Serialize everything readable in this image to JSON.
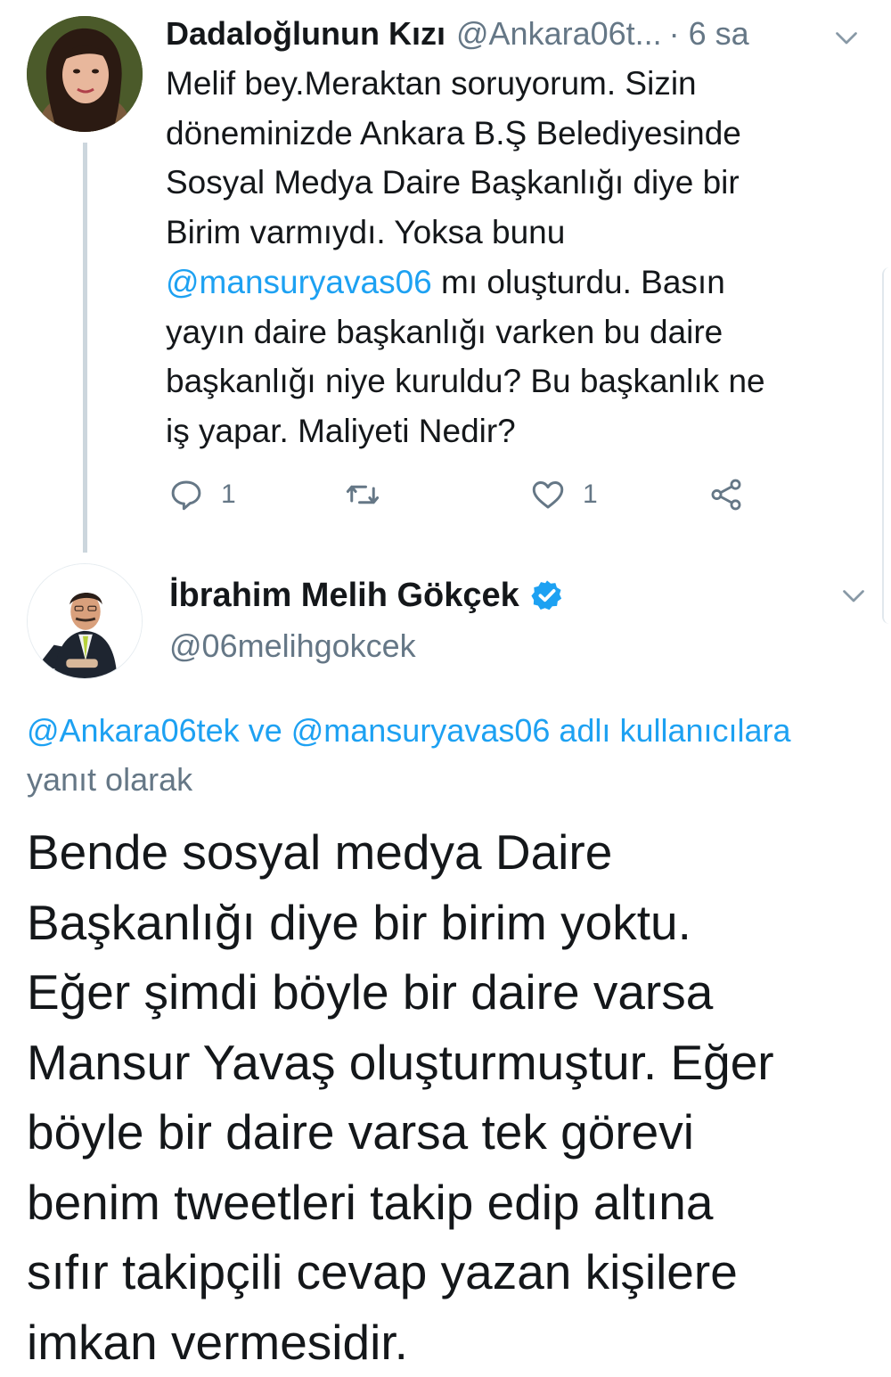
{
  "colors": {
    "link": "#1da1f2",
    "secondary": "#657786",
    "text": "#14171a",
    "verified": "#1da1f2"
  },
  "tweet1": {
    "author_name": "Dadaloğlunun Kızı",
    "handle": "@Ankara06t...",
    "time": "· 6 sa",
    "body_lines": [
      "Melif bey.Meraktan soruyorum. Sizin",
      "döneminizde Ankara B.Ş Belediyesinde",
      "Sosyal Medya Daire Başkanlığı diye bir",
      "Birim varmıydı. Yoksa bunu"
    ],
    "mention": "@mansuryavas06",
    "mention_tail": " mı oluşturdu. Basın",
    "body_lines_2": [
      "yayın daire başkanlığı varken bu daire",
      "başkanlığı niye kuruldu? Bu başkanlık ne",
      "iş yapar. Maliyeti Nedir?"
    ],
    "reply_count": "1",
    "like_count": "1",
    "icons": [
      "reply-icon",
      "retweet-icon",
      "like-icon",
      "share-icon",
      "chevron-down-icon"
    ]
  },
  "tweet2": {
    "author_name": "İbrahim Melih Gökçek",
    "handle": "@06melihgokcek",
    "reply_to": {
      "mention1": "@Ankara06tek",
      "connector": " ve ",
      "mention2": "@mansuryavas06",
      "link_tail": " adlı kullanıcılara",
      "suffix": " yanıt olarak"
    },
    "body_lines": [
      "Bende sosyal medya Daire",
      "Başkanlığı diye bir birim yoktu.",
      "Eğer şimdi böyle bir daire varsa",
      "Mansur Yavaş oluşturmuştur. Eğer",
      "böyle bir daire varsa tek görevi",
      "benim tweetleri takip edip altına",
      "sıfır takipçili cevap yazan kişilere",
      "imkan vermesidir."
    ],
    "icons": [
      "verified-badge-icon",
      "chevron-down-icon"
    ]
  }
}
